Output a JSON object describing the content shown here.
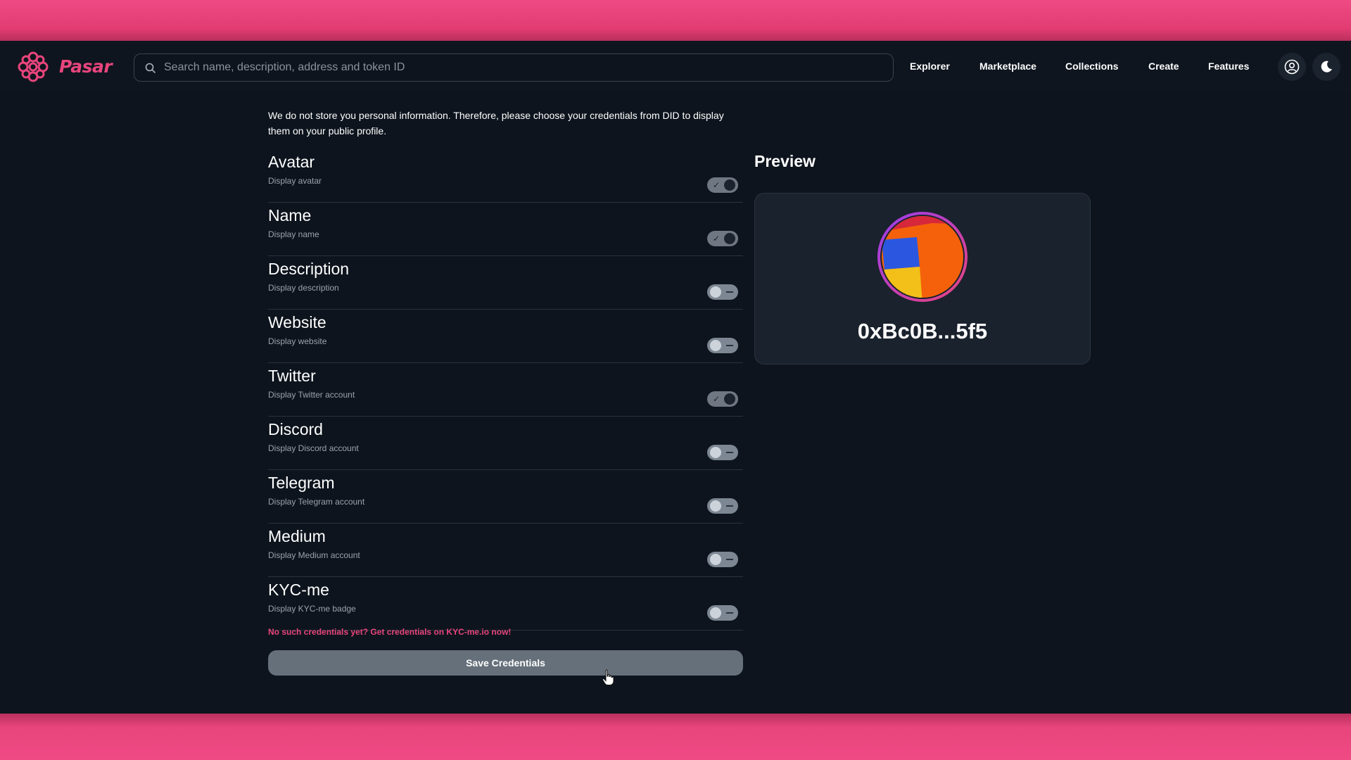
{
  "header": {
    "brand": "Pasar",
    "search_placeholder": "Search name, description, address and token ID",
    "nav": [
      "Explorer",
      "Marketplace",
      "Collections",
      "Create",
      "Features"
    ]
  },
  "intro": "We do not store you personal information. Therefore, please choose your credentials from DID to display them on your public profile.",
  "credentials": [
    {
      "title": "Avatar",
      "desc": "Display avatar",
      "enabled": true
    },
    {
      "title": "Name",
      "desc": "Display name",
      "enabled": true
    },
    {
      "title": "Description",
      "desc": "Display description",
      "enabled": false
    },
    {
      "title": "Website",
      "desc": "Display website",
      "enabled": false
    },
    {
      "title": "Twitter",
      "desc": "Display Twitter account",
      "enabled": true
    },
    {
      "title": "Discord",
      "desc": "Display Discord account",
      "enabled": false
    },
    {
      "title": "Telegram",
      "desc": "Display Telegram account",
      "enabled": false
    },
    {
      "title": "Medium",
      "desc": "Display Medium account",
      "enabled": false
    },
    {
      "title": "KYC-me",
      "desc": "Display KYC-me badge",
      "enabled": false
    }
  ],
  "kyc_link": "No such credentials yet? Get credentials on KYC-me.io now!",
  "save_label": "Save Credentials",
  "preview": {
    "title": "Preview",
    "address": "0xBc0B...5f5"
  },
  "colors": {
    "accent": "#e8457c",
    "background": "#0d141d",
    "card": "#1a222d"
  }
}
